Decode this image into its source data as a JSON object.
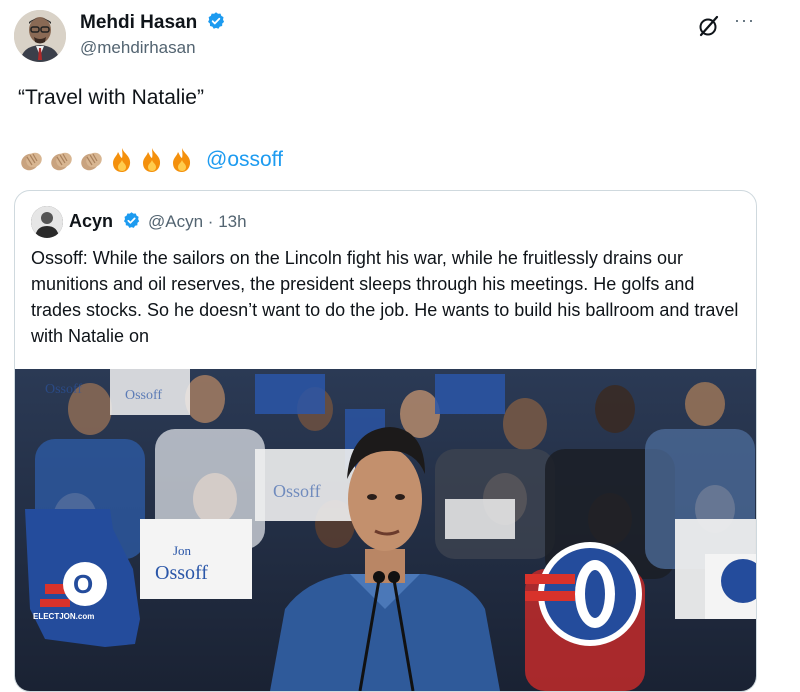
{
  "author": {
    "display_name": "Mehdi Hasan",
    "handle": "@mehdirhasan",
    "verified_icon": "verified-badge-icon"
  },
  "actions": {
    "grok_icon": "grok-icon",
    "more_label": "···"
  },
  "tweet": {
    "text": "“Travel with Natalie”",
    "emojis": [
      "clapping-hands-icon",
      "clapping-hands-icon",
      "clapping-hands-icon",
      "fire-icon",
      "fire-icon",
      "fire-icon"
    ],
    "mention": "@ossoff"
  },
  "quote": {
    "display_name": "Acyn",
    "handle": "@Acyn",
    "separator": "·",
    "time": "13h",
    "text": "Ossoff: While the sailors on the Lincoln fight his war, while he fruitlessly drains our munitions and oil reserves, the president sleeps through his meetings. He golfs and trades stocks. So he doesn’t want to do the job. He wants to build his ballroom and travel with Natalie on",
    "media_sign_text_1": "Jon Ossoff",
    "media_sign_text_2": "Ossoff",
    "media_sign_text_3": "ELECTJON.com"
  },
  "colors": {
    "link": "#1d9bf0",
    "verified": "#1d9bf0",
    "secondary_text": "#536471",
    "border": "#cfd9de",
    "sign_blue": "#1f4fa3",
    "sign_red": "#d8322b"
  }
}
